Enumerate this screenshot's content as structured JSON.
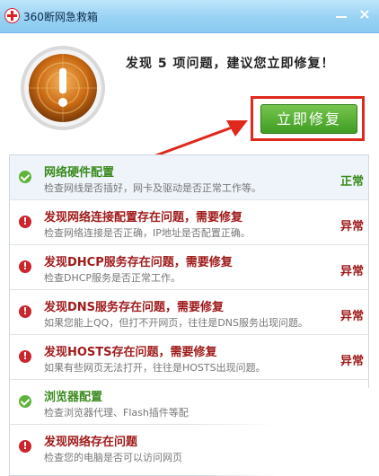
{
  "window": {
    "title": "360断网急救箱"
  },
  "header": {
    "headline": "发现 5 项问题，建议您立即修复！",
    "fix_button": "立即修复"
  },
  "rows": [
    {
      "status": "ok",
      "title": "网络硬件配置",
      "desc": "检查网线是否插好，网卡及驱动是否正常工作等。",
      "status_label": "正常"
    },
    {
      "status": "err",
      "title": "发现网络连接配置存在问题，需要修复",
      "desc": "检查网络连接是否正确，IP地址是否配置正确。",
      "status_label": "异常"
    },
    {
      "status": "err",
      "title": "发现DHCP服务存在问题，需要修复",
      "desc": "检查DHCP服务是否正常工作。",
      "status_label": "异常"
    },
    {
      "status": "err",
      "title": "发现DNS服务存在问题，需要修复",
      "desc": "如果您能上QQ，但打不开网页，往往是DNS服务出现问题。",
      "status_label": "异常"
    },
    {
      "status": "err",
      "title": "发现HOSTS存在问题，需要修复",
      "desc": "如果有些网页无法打开，往往是HOSTS出现问题。",
      "status_label": "异常"
    },
    {
      "status": "ok",
      "title": "浏览器配置",
      "desc": "检查浏览器代理、Flash插件等配",
      "status_label": ""
    },
    {
      "status": "err",
      "title": "发现网络存在问题",
      "desc": "检查您的电脑是否可以访问网页",
      "status_label": ""
    }
  ]
}
